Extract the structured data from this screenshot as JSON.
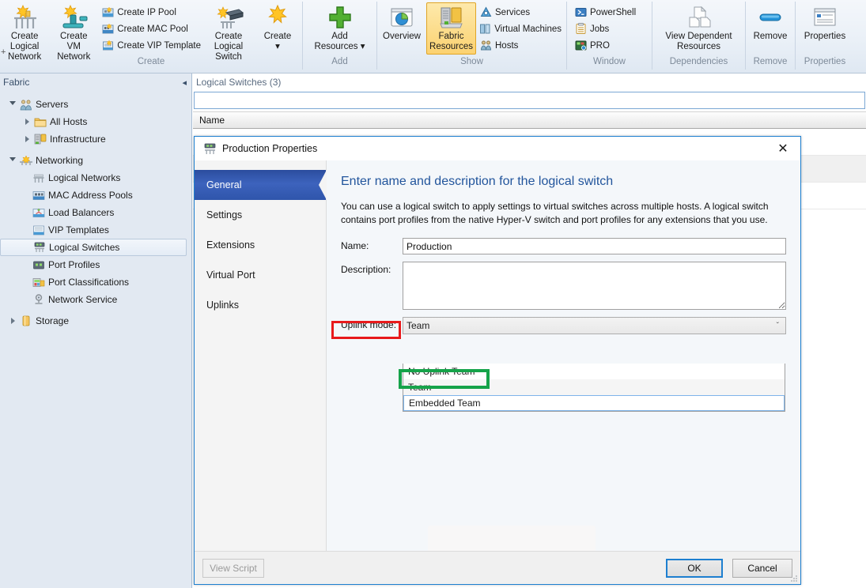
{
  "ribbon": {
    "groups": [
      {
        "label": "Create",
        "big": [
          {
            "name": "create-logical-network",
            "label_line1": "Create Logical",
            "label_line2": "Network",
            "icon": "logical-network-icon"
          },
          {
            "name": "create-vm-network",
            "label_line1": "Create VM",
            "label_line2": "Network",
            "icon": "vm-network-icon"
          }
        ],
        "small": [
          {
            "name": "create-ip-pool",
            "label": "Create IP Pool",
            "icon": "ip-pool-icon"
          },
          {
            "name": "create-mac-pool",
            "label": "Create MAC Pool",
            "icon": "mac-pool-icon"
          },
          {
            "name": "create-vip-template",
            "label": "Create VIP Template",
            "icon": "vip-template-icon"
          }
        ],
        "big2": [
          {
            "name": "create-logical-switch",
            "label_line1": "Create",
            "label_line2": "Logical Switch",
            "icon": "logical-switch-icon"
          },
          {
            "name": "create-menu",
            "label_line1": "Create",
            "label_line2": "▾",
            "icon": "create-star-icon"
          }
        ]
      },
      {
        "label": "Add",
        "big": [
          {
            "name": "add-resources",
            "label_line1": "Add",
            "label_line2": "Resources ▾",
            "icon": "add-plus-icon"
          }
        ]
      },
      {
        "label": "Show",
        "big": [
          {
            "name": "overview",
            "label_line1": "Overview",
            "label_line2": "",
            "icon": "overview-icon"
          },
          {
            "name": "fabric-resources",
            "label_line1": "Fabric",
            "label_line2": "Resources",
            "icon": "fabric-resources-icon",
            "selected": true
          }
        ],
        "small": [
          {
            "name": "services",
            "label": "Services",
            "icon": "services-icon"
          },
          {
            "name": "virtual-machines",
            "label": "Virtual Machines",
            "icon": "virtual-machines-icon"
          },
          {
            "name": "hosts",
            "label": "Hosts",
            "icon": "hosts-icon"
          }
        ]
      },
      {
        "label": "Window",
        "small": [
          {
            "name": "powershell",
            "label": "PowerShell",
            "icon": "powershell-icon"
          },
          {
            "name": "jobs",
            "label": "Jobs",
            "icon": "jobs-icon"
          },
          {
            "name": "pro",
            "label": "PRO",
            "icon": "pro-icon"
          }
        ]
      },
      {
        "label": "Dependencies",
        "big": [
          {
            "name": "view-dependent-resources",
            "label_line1": "View Dependent",
            "label_line2": "Resources",
            "icon": "dependent-resources-icon"
          }
        ]
      },
      {
        "label": "Remove",
        "big": [
          {
            "name": "remove",
            "label_line1": "Remove",
            "label_line2": "",
            "icon": "remove-icon"
          }
        ]
      },
      {
        "label": "Properties",
        "big": [
          {
            "name": "properties",
            "label_line1": "Properties",
            "label_line2": "",
            "icon": "properties-icon"
          }
        ]
      }
    ]
  },
  "sidebar": {
    "title": "Fabric",
    "collapse_glyph": "◂",
    "items": [
      {
        "label": "Servers",
        "level": 0,
        "expanded": true,
        "icon": "servers-icon"
      },
      {
        "label": "All Hosts",
        "level": 1,
        "expanded": false,
        "icon": "folder-icon"
      },
      {
        "label": "Infrastructure",
        "level": 1,
        "expanded": false,
        "icon": "infrastructure-icon"
      },
      {
        "label": "Networking",
        "level": 0,
        "expanded": true,
        "icon": "networking-icon"
      },
      {
        "label": "Logical Networks",
        "level": 2,
        "icon": "logical-networks-icon"
      },
      {
        "label": "MAC Address Pools",
        "level": 2,
        "icon": "mac-pools-icon"
      },
      {
        "label": "Load Balancers",
        "level": 2,
        "icon": "load-balancers-icon"
      },
      {
        "label": "VIP Templates",
        "level": 2,
        "icon": "vip-templates-icon"
      },
      {
        "label": "Logical Switches",
        "level": 2,
        "icon": "logical-switches-icon",
        "selected": true
      },
      {
        "label": "Port Profiles",
        "level": 2,
        "icon": "port-profiles-icon"
      },
      {
        "label": "Port Classifications",
        "level": 2,
        "icon": "port-classifications-icon"
      },
      {
        "label": "Network Service",
        "level": 2,
        "icon": "network-service-icon"
      },
      {
        "label": "Storage",
        "level": 0,
        "expanded": false,
        "icon": "storage-icon"
      }
    ]
  },
  "main": {
    "title": "Logical Switches (3)",
    "filter_value": "",
    "column_header": "Name"
  },
  "dialog": {
    "title": "Production Properties",
    "title_icon": "logical-switch-icon",
    "close_glyph": "✕",
    "nav": [
      {
        "label": "General",
        "active": true
      },
      {
        "label": "Settings",
        "active": false
      },
      {
        "label": "Extensions",
        "active": false
      },
      {
        "label": "Virtual Port",
        "active": false
      },
      {
        "label": "Uplinks",
        "active": false
      }
    ],
    "heading": "Enter name and description for the logical switch",
    "description": "You can use a logical switch to apply settings to virtual switches across multiple hosts. A logical switch contains port profiles from the native Hyper-V switch and port profiles for any extensions that you use.",
    "fields": {
      "name_label": "Name:",
      "name_value": "Production",
      "description_label": "Description:",
      "description_value": "",
      "uplink_label": "Uplink mode:",
      "uplink_value": "Team",
      "uplink_chevron": "ˇ"
    },
    "dropdown_options": [
      {
        "label": "No Uplink Team",
        "highlighted": false
      },
      {
        "label": "Team",
        "highlighted": false
      },
      {
        "label": "Embedded Team",
        "highlighted": true
      }
    ],
    "buttons": {
      "view_script": "View Script",
      "ok": "OK",
      "cancel": "Cancel"
    }
  },
  "annotations": {
    "red_box_target": "Uplink mode:",
    "green_box_target": "Embedded Team",
    "red_color": "#e8191b",
    "green_color": "#16a34a"
  }
}
